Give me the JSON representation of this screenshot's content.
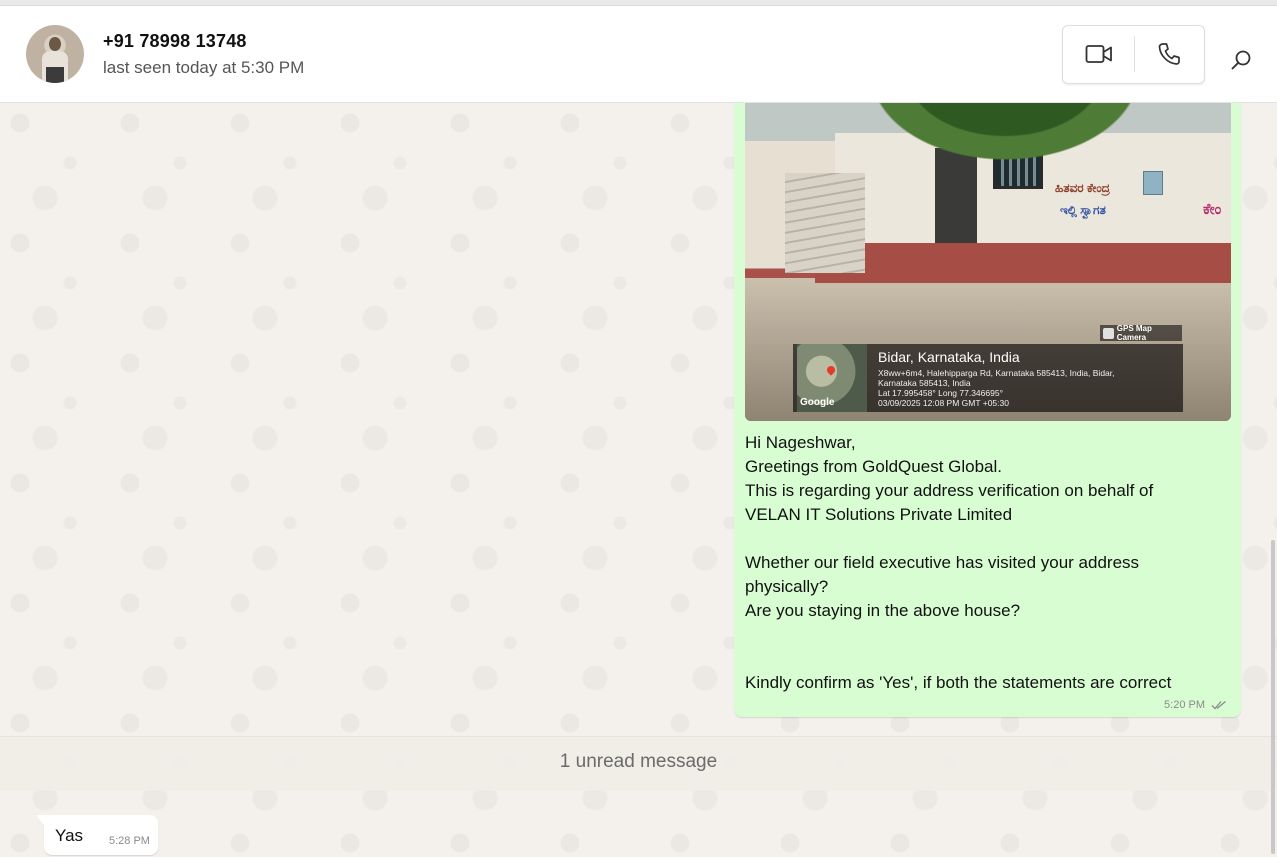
{
  "contact": {
    "name": "+91 78998 13748",
    "status": "last seen today at 5:30 PM"
  },
  "toolbar": {
    "video_icon": "video-camera-icon",
    "phone_icon": "phone-icon",
    "search_icon": "search-icon"
  },
  "outgoing": {
    "photo_overlay": {
      "badge": "GPS Map Camera",
      "place": "Bidar, Karnataka, India",
      "address_lines": [
        "X8ww+6m4, Halehipparga Rd, Karnataka 585413, India, Bidar,",
        "Karnataka 585413, India",
        "Lat 17.995458° Long 77.346695°",
        "03/09/2025 12:08 PM GMT +05:30"
      ],
      "map_label": "Google"
    },
    "lines": [
      "Hi Nageshwar,",
      "Greetings from GoldQuest Global.",
      "This is regarding your address verification on behalf of",
      "VELAN IT Solutions Private Limited",
      "",
      "Whether our field executive has visited your address",
      "physically?",
      "Are you staying in the above house?",
      "",
      "",
      "Kindly confirm as 'Yes', if both the statements are correct"
    ],
    "time": "5:20 PM"
  },
  "unread": {
    "label": "1 unread message"
  },
  "incoming": {
    "text": "Yas",
    "time": "5:28 PM"
  },
  "colors": {
    "outgoing_bubble": "#d9fdd3",
    "incoming_bubble": "#ffffff",
    "chat_background": "#f4f1ec"
  }
}
